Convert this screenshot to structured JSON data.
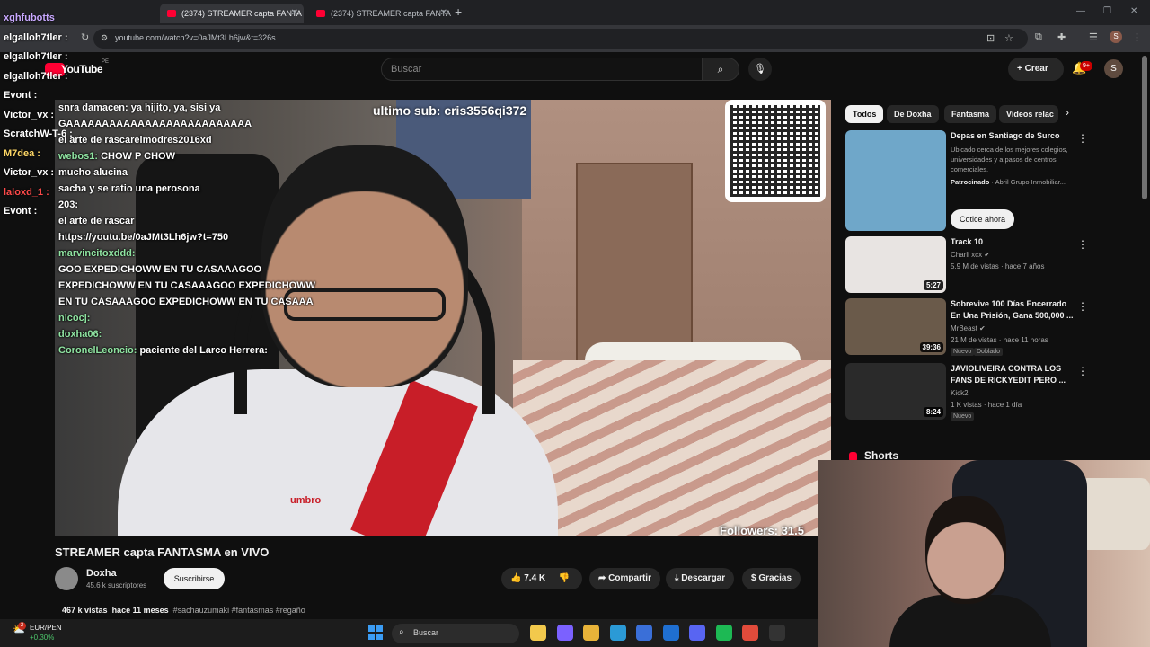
{
  "browser": {
    "tabs": [
      {
        "label": "(2374) STREAMER capta FANTA",
        "active": true
      },
      {
        "label": "(2374) STREAMER capta FANTA",
        "active": false
      }
    ],
    "new_tab_glyph": "+",
    "url": "youtube.com/watch?v=0aJMt3Lh6jw&t=326s",
    "window_controls": [
      "—",
      "❐",
      "✕"
    ],
    "profile_initial": "S"
  },
  "header": {
    "logo_text": "YouTube",
    "country_code": "PE",
    "search_placeholder": "Buscar",
    "create_label": "Crear",
    "notification_count": "9+",
    "avatar_initial": "S"
  },
  "overlay": {
    "last_sub": "ultimo sub: cris3556qi372",
    "followers": "Followers: 31.5",
    "outside_chat": [
      {
        "user": "xghfubotts",
        "color": "#c8a8ff"
      },
      {
        "user": "elgalloh7tler :",
        "color": "#ffffff"
      },
      {
        "user": "elgalloh7tler :",
        "color": "#ffffff"
      },
      {
        "user": "elgalloh7tler :",
        "color": "#ffffff"
      },
      {
        "user": "Evont :",
        "color": "#ffffff"
      },
      {
        "user": "Victor_vx :",
        "color": "#ffffff"
      },
      {
        "user": "ScratchW-T-6 :",
        "color": "#ffffff"
      },
      {
        "user": "M7dea :",
        "color": "#ffd866"
      },
      {
        "user": "Victor_vx :",
        "color": "#ffffff"
      },
      {
        "user": "laloxd_1 :",
        "color": "#ff4a4a"
      },
      {
        "user": "Evont :",
        "color": "#ffffff"
      }
    ],
    "video_chat": [
      {
        "user": "",
        "text": "snra damacen: ya hijito, ya, sisi ya"
      },
      {
        "user": "",
        "text": "GAAAAAAAAAAAAAAAAAAAAAAAAAA"
      },
      {
        "user": "",
        "text": "el arte de rascarelmodres2016xd"
      },
      {
        "user": "webos1:",
        "text": "CHOW P CHOW"
      },
      {
        "user": "",
        "text": "mucho alucina"
      },
      {
        "user": "",
        "text": "sacha y se ratio una perosona"
      },
      {
        "user": "",
        "text": "203:"
      },
      {
        "user": "",
        "text": "el arte de rascar"
      },
      {
        "user": "",
        "text": "https://youtu.be/0aJMt3Lh6jw?t=750"
      },
      {
        "user": "marvincitoxddd:",
        "text": ""
      },
      {
        "user": "",
        "text": "GOO EXPEDICHOWW EN TU CASAAAGOO EXPEDICHOWW EN TU CASAAAGOO EXPEDICHOWW EN TU CASAAAGOO EXPEDICHOWW EN TU CASAAA"
      },
      {
        "user": "nicocj:",
        "text": ""
      },
      {
        "user": "doxha06:",
        "text": ""
      },
      {
        "user": "CoronelLeoncio:",
        "text": "paciente del Larco Herrera:"
      }
    ],
    "shirt_brand": "umbro"
  },
  "video": {
    "title": "STREAMER capta FANTASMA en VIVO",
    "channel_name": "Doxha",
    "subscribers": "45.6 k suscriptores",
    "subscribe_label": "Suscribirse",
    "like_count": "7.4 K",
    "share_label": "Compartir",
    "download_label": "Descargar",
    "thanks_label": "Gracias",
    "views": "467 k vistas",
    "published": "hace 11 meses",
    "tags": "#sachauzumaki #fantasmas #regaño"
  },
  "chips": [
    "Todos",
    "De Doxha",
    "Fantasma",
    "Videos relac"
  ],
  "recommendations": [
    {
      "type": "ad",
      "title": "Depas en Santiago de Surco",
      "description": "Ubicado cerca de los mejores colegios, universidades y a pasos de centros comerciales.",
      "sponsor_label": "Patrocinado",
      "sponsor": "Abril Grupo Inmobiliar...",
      "cta": "Cotice ahora",
      "thumb_color": "#6fa7c9"
    },
    {
      "title": "Track 10",
      "channel": "Charli xcx",
      "meta": "5.9 M de vistas · hace 7 años",
      "duration": "5:27",
      "thumb_color": "#e8e4e2"
    },
    {
      "title": "Sobrevive 100 Días Encerrado En Una Prisión, Gana 500,000 ...",
      "channel": "MrBeast",
      "meta": "21 M de vistas · hace 11 horas",
      "duration": "39:36",
      "badges": [
        "Nuevo",
        "Doblado"
      ],
      "thumb_color": "#6a5a4a"
    },
    {
      "title": "JAVIOLIVEIRA CONTRA LOS FANS DE RICKYEDIT PERO ...",
      "channel": "Kick2",
      "meta": "1 K vistas · hace 1 día",
      "duration": "8:24",
      "badges": [
        "Nuevo"
      ],
      "thumb_color": "#2a2a2a"
    }
  ],
  "shorts_label": "Shorts",
  "taskbar": {
    "fx_pair": "EUR/PEN",
    "fx_change": "+0.30%",
    "weather_badge": "2",
    "search_placeholder": "Buscar",
    "apps": [
      {
        "name": "file-explorer",
        "color": "#f2c94c"
      },
      {
        "name": "copilot",
        "color": "#7b61ff"
      },
      {
        "name": "folder",
        "color": "#e8b339"
      },
      {
        "name": "edge",
        "color": "#2b9ad6"
      },
      {
        "name": "store",
        "color": "#3a6fd8"
      },
      {
        "name": "outlook",
        "color": "#1f6fd1"
      },
      {
        "name": "discord",
        "color": "#5865f2"
      },
      {
        "name": "spotify",
        "color": "#1db954"
      },
      {
        "name": "chrome",
        "color": "#e14b3b"
      },
      {
        "name": "obs",
        "color": "#333333"
      }
    ]
  }
}
